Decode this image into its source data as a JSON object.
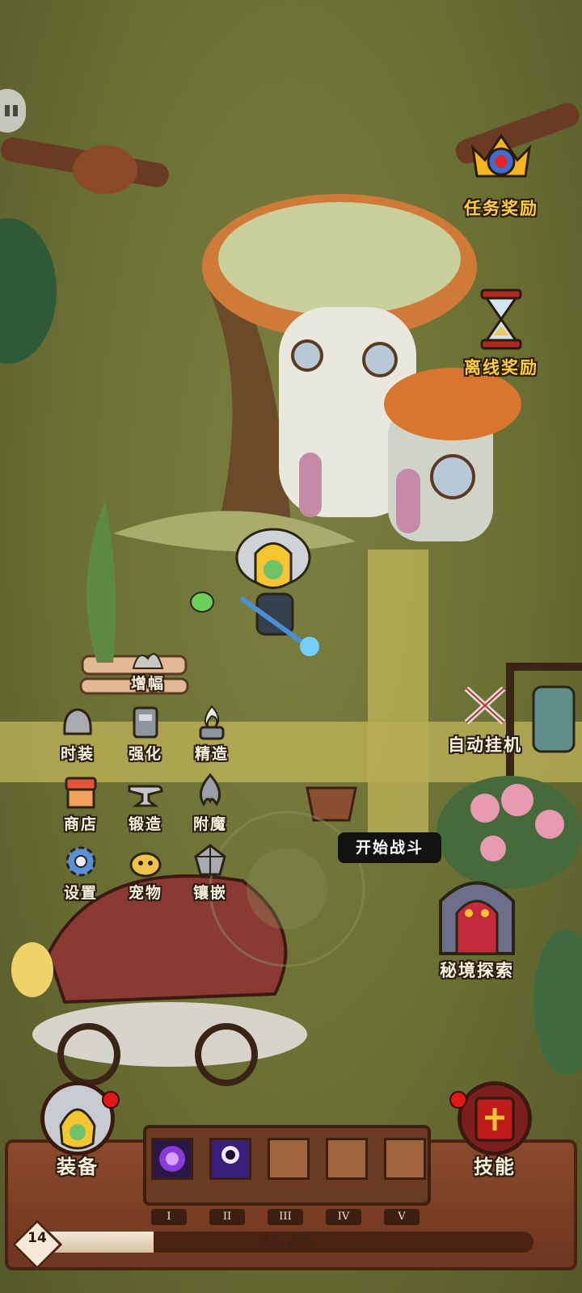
{
  "colors": {
    "grass": "#6f7436",
    "path": "#b7ad55",
    "panel": "#8b4a2b",
    "gold_text": "#ffcf3a",
    "notify_dot": "#e01818"
  },
  "top_right": {
    "quest_reward": {
      "label": "任务奖励",
      "icon": "crown-medal-icon"
    },
    "offline_reward": {
      "label": "离线奖励",
      "icon": "hourglass-icon"
    }
  },
  "town_menu": {
    "amplify": "增幅",
    "items": [
      {
        "key": "fashion",
        "label": "时装",
        "icon": "helmet-icon"
      },
      {
        "key": "enhance",
        "label": "强化",
        "icon": "book-icon"
      },
      {
        "key": "refine",
        "label": "精造",
        "icon": "forge-flame-icon"
      },
      {
        "key": "shop",
        "label": "商店",
        "icon": "shop-stall-icon"
      },
      {
        "key": "forge",
        "label": "锻造",
        "icon": "anvil-icon"
      },
      {
        "key": "enchant",
        "label": "附魔",
        "icon": "enchant-flame-icon"
      },
      {
        "key": "settings",
        "label": "设置",
        "icon": "gear-icon"
      },
      {
        "key": "pet",
        "label": "宠物",
        "icon": "pet-icon"
      },
      {
        "key": "inlay",
        "label": "镶嵌",
        "icon": "gem-icon"
      }
    ]
  },
  "auto_idle": {
    "label": "自动挂机",
    "icon": "crossed-swords-icon"
  },
  "start_battle": {
    "label": "开始战斗"
  },
  "secret_realm": {
    "label": "秘境探索",
    "icon": "dungeon-gate-icon"
  },
  "bottom_bar": {
    "equipment_label": "装备",
    "skills_label": "技能",
    "slots": [
      {
        "numeral": "I",
        "filled": true,
        "icon": "purple-orb-skill-icon"
      },
      {
        "numeral": "II",
        "filled": true,
        "icon": "dark-portal-skill-icon"
      },
      {
        "numeral": "III",
        "filled": false
      },
      {
        "numeral": "IV",
        "filled": false
      },
      {
        "numeral": "V",
        "filled": false
      }
    ],
    "level": "14",
    "xp_text": "23.2%",
    "xp_fraction": 0.232
  }
}
